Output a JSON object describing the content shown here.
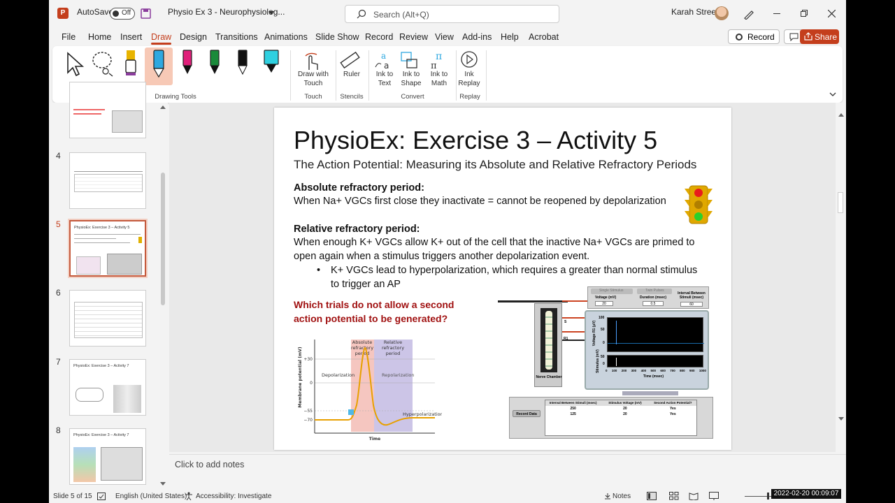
{
  "titlebar": {
    "app_logo": "P",
    "autosave_label": "AutoSave",
    "autosave_state": "Off",
    "doc_title": "Physio Ex 3 - Neurophysiolog...",
    "search_placeholder": "Search (Alt+Q)",
    "user_name": "Karah Street"
  },
  "menu": {
    "items": [
      "File",
      "Home",
      "Insert",
      "Draw",
      "Design",
      "Transitions",
      "Animations",
      "Slide Show",
      "Record",
      "Review",
      "View",
      "Add-ins",
      "Help",
      "Acrobat"
    ],
    "active": "Draw",
    "record_label": "Record",
    "share_label": "Share"
  },
  "ribbon": {
    "groups": {
      "drawing_tools": "Drawing Tools",
      "touch": "Touch",
      "stencils": "Stencils",
      "convert": "Convert",
      "replay": "Replay"
    },
    "buttons": {
      "draw_with_touch": "Draw with Touch",
      "ruler": "Ruler",
      "ink_to_text": "Ink to Text",
      "ink_to_shape": "Ink to Shape",
      "ink_to_math": "Ink to Math",
      "ink_replay": "Ink Replay"
    },
    "pen_colors": [
      "#e8b400",
      "#2ea8e0",
      "#e0207a",
      "#1a8a3a",
      "#111111",
      "#2fd0e0"
    ]
  },
  "thumbnails": [
    {
      "num": "",
      "title": ""
    },
    {
      "num": "4",
      "title": ""
    },
    {
      "num": "5",
      "title": "PhysioEx: Exercise 3 – Activity 5"
    },
    {
      "num": "6",
      "title": ""
    },
    {
      "num": "7",
      "title": "PhysioEx: Exercise 3 – Activity 7"
    },
    {
      "num": "8",
      "title": "PhysioEx: Exercise 3 – Activity 7"
    }
  ],
  "slide": {
    "title": "PhysioEx: Exercise 3 – Activity 5",
    "subtitle": "The Action Potential: Measuring its Absolute and Relative Refractory Periods",
    "abs_heading": "Absolute refractory period:",
    "abs_text": "When Na+ VGCs first close they inactivate = cannot be reopened by depolarization",
    "rel_heading": "Relative refractory period:",
    "rel_text_1": "When enough K+ VGCs allow K+ out of the cell that the inactive Na+ VGCs are primed to",
    "rel_text_2": "open again when a stimulus triggers another depolarization event.",
    "bullet_1": "K+ VGCs lead to hyperpolarization, which requires a greater than normal stimulus",
    "bullet_2": "to trigger an AP",
    "question_1": "Which trials do not allow a second",
    "question_2": "action potential to be generated?",
    "graph": {
      "abs_label_1": "Absolute",
      "abs_label_2": "refractory",
      "abs_label_3": "period",
      "rel_label_1": "Relative",
      "rel_label_2": "refractory",
      "rel_label_3": "period",
      "y_axis": "Membrane potential (mV)",
      "x_axis": "Time",
      "tick_30": "+30",
      "tick_0": "0",
      "tick_55": "−55",
      "tick_70": "−70",
      "depol": "Depolarization",
      "repol": "Repolarization",
      "hyperpol": "Hyperpolarization"
    },
    "sim": {
      "single_stimulus": "Single Stimulus",
      "twin_pulses": "Twin Pulses",
      "voltage_label": "Voltage (mV)",
      "voltage_value": "20",
      "duration_label": "Duration (msec)",
      "duration_value": "0.5",
      "interval_label": "Interval Between Stimuli (msec)",
      "interval_value": "60",
      "nerve_chamber": "Nerve Chamber",
      "s_label": "S",
      "r1_label": "R1",
      "y1_ticks": [
        "100",
        "50",
        "0"
      ],
      "y2_ticks": [
        "50",
        "0"
      ],
      "x_ticks": [
        "0",
        "100",
        "200",
        "300",
        "400",
        "500",
        "600",
        "700",
        "800",
        "900",
        "1000"
      ],
      "y1_label": "Voltage R1 (µV)",
      "y2_label": "Stimulus (mV)",
      "x_label": "Time (msec)",
      "record_data": "Record Data",
      "table_headers": [
        "Interval Between Stimuli (msec)",
        "Stimulus Voltage (mV)",
        "Second Action Potential?"
      ],
      "table_rows": [
        [
          "250",
          "20",
          "Yes"
        ],
        [
          "125",
          "20",
          "Yes"
        ]
      ]
    }
  },
  "notes_placeholder": "Click to add notes",
  "status": {
    "slide_info": "Slide 5 of 15",
    "language": "English (United States)",
    "accessibility": "Accessibility: Investigate",
    "notes_label": "Notes",
    "timestamp": "2022-02-20  00:09:07"
  }
}
